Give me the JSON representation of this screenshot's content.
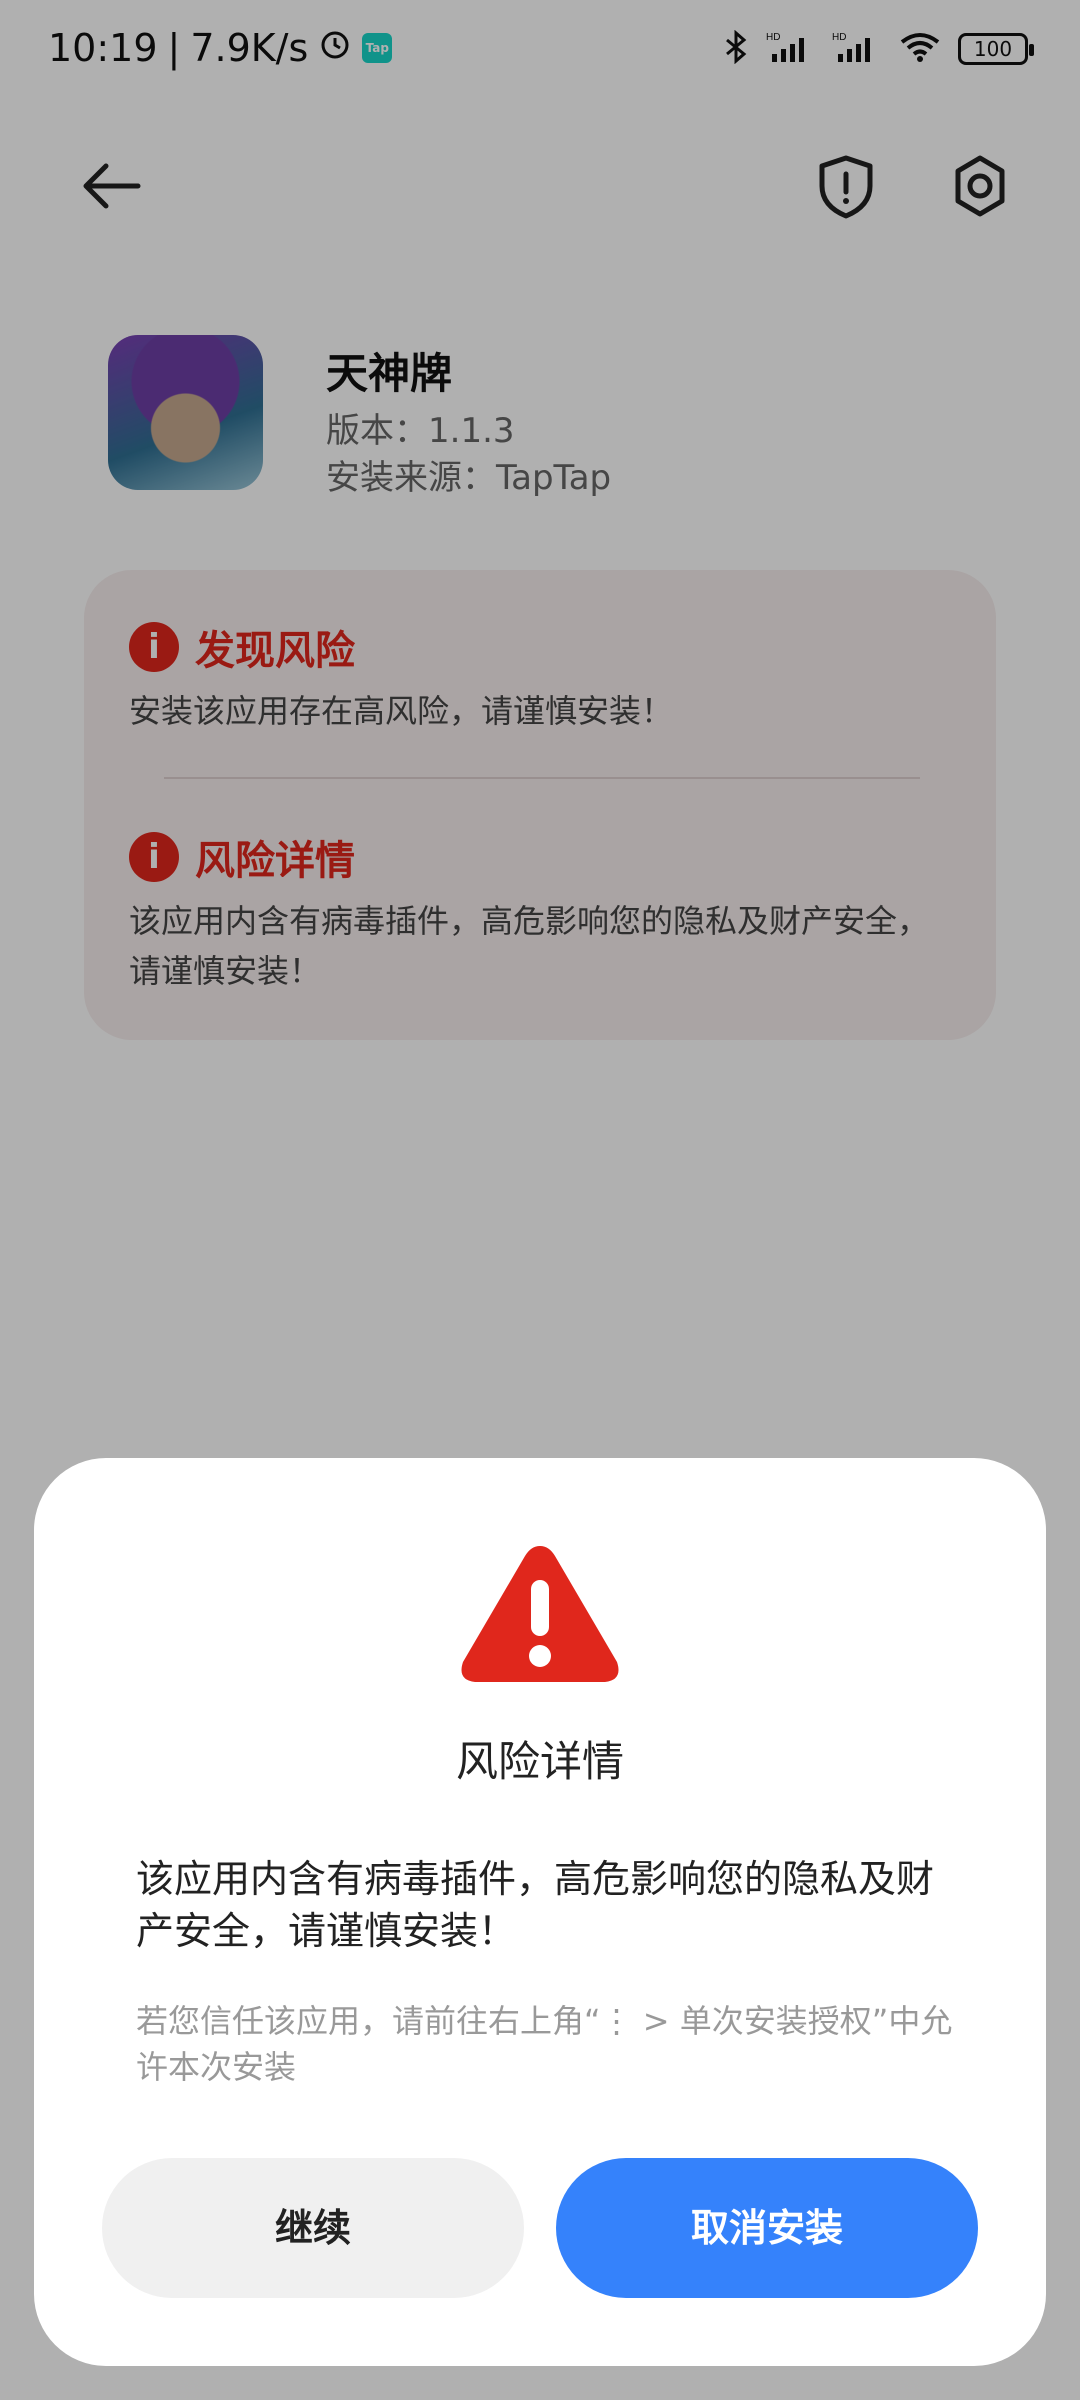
{
  "status_bar": {
    "time": "10:19",
    "separator": "|",
    "speed": "7.9K/s",
    "tap_badge": "Tap",
    "network": "HD",
    "battery": "100"
  },
  "app": {
    "name": "天神牌",
    "version_line": "版本：1.1.3",
    "source_line": "安装来源：TapTap"
  },
  "risk": {
    "found_title": "发现风险",
    "found_text": "安装该应用存在高风险，请谨慎安装！",
    "detail_title": "风险详情",
    "detail_text": "该应用内含有病毒插件，高危影响您的隐私及财产安全，请谨慎安装！"
  },
  "dialog": {
    "title": "风险详情",
    "message": "该应用内含有病毒插件，高危影响您的隐私及财产安全，请谨慎安装！",
    "hint": "若您信任该应用，请前往右上角“⋮ > 单次安装授权”中允许本次安装",
    "continue_label": "继续",
    "cancel_label": "取消安装"
  },
  "colors": {
    "danger": "#e0271c",
    "primary": "#3582fb",
    "scrim": "rgba(0,0,0,0.31)"
  },
  "icons": {
    "back": "back-arrow-icon",
    "shield": "shield-alert-icon",
    "settings": "settings-gear-icon",
    "warning": "warning-triangle-icon",
    "info": "info-circle-icon"
  }
}
